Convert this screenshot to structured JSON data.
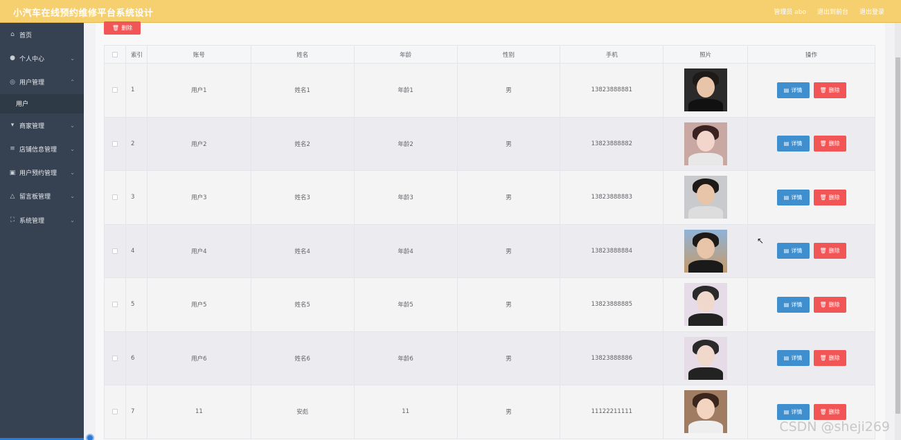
{
  "app": {
    "title": "小汽车在线预约维修平台系统设计"
  },
  "header": {
    "admin_label": "管理员 abo",
    "backend_link": "退出到前台",
    "logout_link": "退出登录"
  },
  "sidebar": {
    "items": [
      {
        "label": "首页",
        "icon": "home-icon",
        "glyph": "⌂",
        "chevron": ""
      },
      {
        "label": "个人中心",
        "icon": "user-icon",
        "glyph": "●",
        "chevron": "⌄"
      },
      {
        "label": "用户管理",
        "icon": "globe-icon",
        "glyph": "◎",
        "chevron": "⌃"
      },
      {
        "label": "商家管理",
        "icon": "shop-icon",
        "glyph": "▾",
        "chevron": "⌄"
      },
      {
        "label": "店铺信息管理",
        "icon": "list-icon",
        "glyph": "≡",
        "chevron": "⌄"
      },
      {
        "label": "用户预约管理",
        "icon": "chart-icon",
        "glyph": "▣",
        "chevron": "⌄"
      },
      {
        "label": "留言板管理",
        "icon": "bell-icon",
        "glyph": "△",
        "chevron": "⌄"
      },
      {
        "label": "系统管理",
        "icon": "expand-icon",
        "glyph": "⛶",
        "chevron": "⌄"
      }
    ],
    "sub_item": "用户"
  },
  "toolbar": {
    "delete_label": "删除",
    "delete_icon": "trash-icon"
  },
  "table": {
    "columns": [
      "",
      "索引",
      "账号",
      "姓名",
      "年龄",
      "性别",
      "手机",
      "照片",
      "操作"
    ],
    "rows": [
      {
        "index": "1",
        "account": "用户1",
        "name": "姓名1",
        "age": "年龄1",
        "sex": "男",
        "phone": "13823888881"
      },
      {
        "index": "2",
        "account": "用户2",
        "name": "姓名2",
        "age": "年龄2",
        "sex": "男",
        "phone": "13823888882"
      },
      {
        "index": "3",
        "account": "用户3",
        "name": "姓名3",
        "age": "年龄3",
        "sex": "男",
        "phone": "13823888883"
      },
      {
        "index": "4",
        "account": "用户4",
        "name": "姓名4",
        "age": "年龄4",
        "sex": "男",
        "phone": "13823888884"
      },
      {
        "index": "5",
        "account": "用户5",
        "name": "姓名5",
        "age": "年龄5",
        "sex": "男",
        "phone": "13823888885"
      },
      {
        "index": "6",
        "account": "用户6",
        "name": "姓名6",
        "age": "年龄6",
        "sex": "男",
        "phone": "13823888886"
      },
      {
        "index": "7",
        "account": "11",
        "name": "安彪",
        "age": "11",
        "sex": "男",
        "phone": "11122211111"
      }
    ],
    "detail_label": "详情",
    "delete_label": "删除"
  },
  "watermark": "CSDN @sheji269",
  "colors": {
    "header": "#f6cf6e",
    "sidebar": "#364251",
    "primary": "#3f8fcf",
    "danger": "#f25555"
  }
}
